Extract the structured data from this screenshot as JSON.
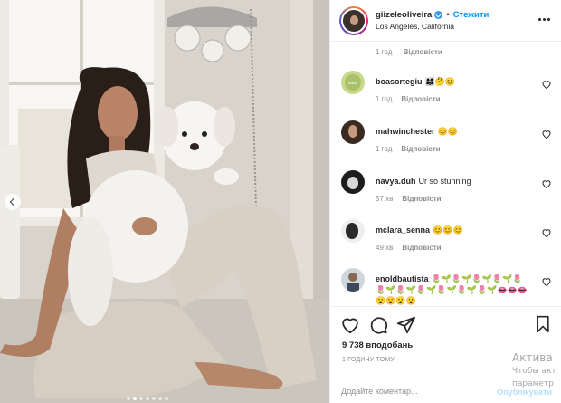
{
  "post": {
    "username": "giizeleoliveira",
    "separator": "•",
    "follow_label": "Стежити",
    "location": "Los Angeles, California",
    "photo_dots_count": 7,
    "photo_active_dot": 1
  },
  "first_comment_meta": {
    "time": "1 год",
    "reply": "Відповісти"
  },
  "comments": [
    {
      "user": "boasortegiu",
      "text": "👩‍👩‍👦🤔😊",
      "time": "1 год",
      "reply": "Відповісти"
    },
    {
      "user": "mahwinchester",
      "text": "😊😊",
      "time": "1 год",
      "reply": "Відповісти"
    },
    {
      "user": "navya.duh",
      "text": "Ur so stunning",
      "time": "57 хв",
      "reply": "Відповісти"
    },
    {
      "user": "mclara_senna",
      "text": "😊😊😊",
      "time": "49 хв",
      "reply": "Відповісти"
    },
    {
      "user": "enoldbautista",
      "text": "🌷🌱🌷🌱🌷🌱🌷🌱🌷🌷🌱🌷🌱🌷🌱🌷🌱🌷🌱🌷🌱👄👄👄😮😮😮😮",
      "time": "",
      "reply": ""
    }
  ],
  "stats": {
    "likes": "9 738 вподобань",
    "time_ago": "1 ГОДИНУ ТОМУ"
  },
  "comment_box": {
    "placeholder": "Додайте коментар...",
    "publish_label": "Опублікувати"
  },
  "windows_activation": {
    "line1": "Актива",
    "line2": "Чтобы акт",
    "line3": "параметр"
  },
  "colors": {
    "accent": "#0095f6",
    "publish_disabled": "#b2dffc",
    "muted": "#8e8e8e",
    "text": "#262626"
  },
  "icons": {
    "like": "heart-icon",
    "comment": "comment-icon",
    "share": "paper-plane-icon",
    "save": "bookmark-icon",
    "more": "more-options-icon",
    "verified": "verified-badge-icon",
    "prev": "chevron-left-icon"
  }
}
